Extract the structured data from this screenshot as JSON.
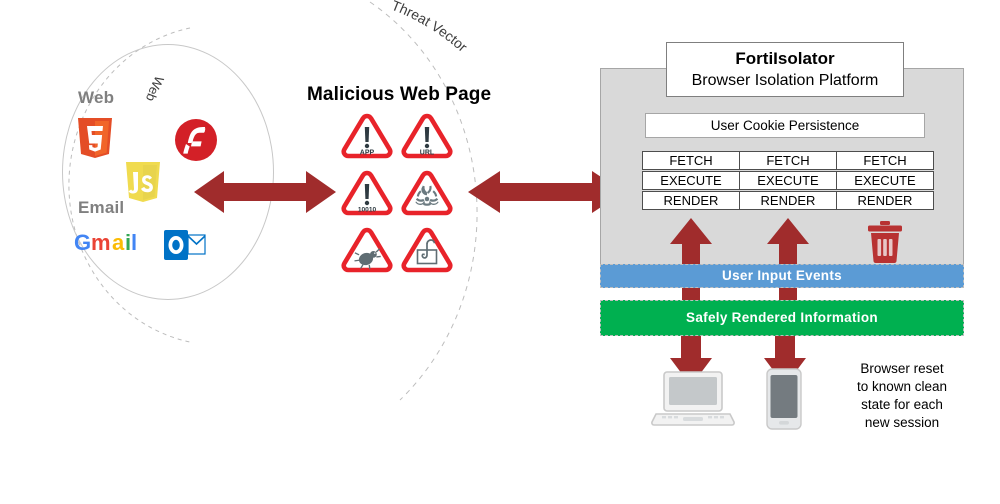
{
  "diagram": {
    "title": "FortiIsolator Browser Isolation Platform Diagram",
    "colors": {
      "arrow_red": "#a02c2c",
      "panel_grey": "#d9d9d9",
      "band_blue": "#5b9bd5",
      "band_green": "#00b050",
      "warning_red": "#e8232a",
      "trash_red": "#b83232"
    }
  },
  "left": {
    "curved_label": "Web",
    "groups": [
      {
        "label": "Web",
        "icons": [
          {
            "name": "html5-logo",
            "text": "5"
          },
          {
            "name": "javascript-logo",
            "text": "JS"
          },
          {
            "name": "flash-logo",
            "text": "f"
          }
        ]
      },
      {
        "label": "Email",
        "icons": [
          {
            "name": "gmail-logo",
            "text": "Gmail"
          },
          {
            "name": "outlook-logo",
            "text": "O"
          }
        ]
      }
    ]
  },
  "center": {
    "curved_label": "Threat Vector",
    "title": "Malicious Web Page",
    "threats": [
      {
        "icon": "warning-triangle-exclamation-icon",
        "label": "APP"
      },
      {
        "icon": "warning-triangle-exclamation-icon",
        "label": "URL"
      },
      {
        "icon": "warning-triangle-exclamation-icon",
        "label": "10010"
      },
      {
        "icon": "warning-triangle-biohazard-icon",
        "label": ""
      },
      {
        "icon": "warning-triangle-bug-icon",
        "label": ""
      },
      {
        "icon": "warning-triangle-phishing-mail-icon",
        "label": ""
      }
    ]
  },
  "arrows": {
    "left_double": "bidirectional-arrow",
    "right_double": "bidirectional-arrow"
  },
  "platform": {
    "title": "FortiIsolator",
    "subtitle": "Browser Isolation Platform",
    "cookie_bar": "User Cookie Persistence",
    "stacks": [
      {
        "cells": [
          "FETCH",
          "EXECUTE",
          "RENDER"
        ]
      },
      {
        "cells": [
          "FETCH",
          "EXECUTE",
          "RENDER"
        ]
      },
      {
        "cells": [
          "FETCH",
          "EXECUTE",
          "RENDER"
        ]
      }
    ],
    "trash_icon": "trash-can-icon",
    "band_input": "User Input Events",
    "band_safe": "Safely Rendered Information"
  },
  "bottom": {
    "note": "Browser reset to known clean state for each new session",
    "note_lines": [
      "Browser reset",
      "to known  clean",
      "state for each",
      "new  session"
    ],
    "devices": [
      {
        "name": "laptop-icon"
      },
      {
        "name": "smartphone-icon"
      }
    ]
  }
}
